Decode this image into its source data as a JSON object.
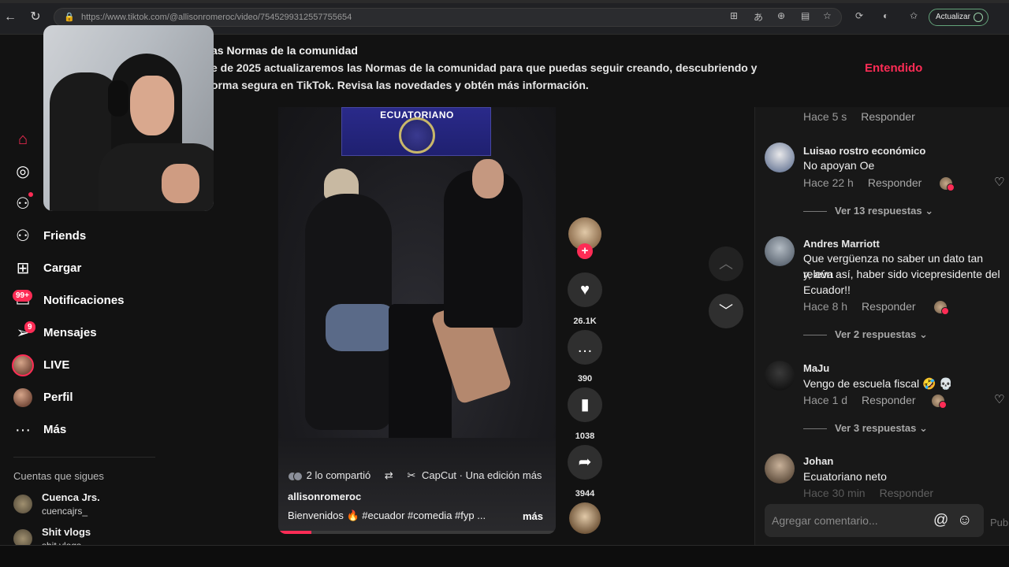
{
  "browser": {
    "url": "https://www.tiktok.com/@allisonromeroc/video/7545299312557755654",
    "update_label": "Actualizar"
  },
  "banner": {
    "line1": "as Normas de la comunidad",
    "line2": "e de 2025 actualizaremos las Normas de la comunidad para que puedas seguir creando, descubriendo y",
    "line3": "orma segura en TikTok. Revisa las novedades y obtén más información.",
    "ok_label": "Entendido"
  },
  "sidebar": {
    "items": [
      {
        "label": "Friends"
      },
      {
        "label": "Cargar"
      },
      {
        "label": "Notificaciones",
        "badge": "99+"
      },
      {
        "label": "Mensajes",
        "badge": "9"
      },
      {
        "label": "LIVE"
      },
      {
        "label": "Perfil"
      },
      {
        "label": "Más"
      }
    ],
    "following_title": "Cuentas que sigues",
    "accounts": [
      {
        "name": "Cuenca Jrs.",
        "handle": "cuencajrs_"
      },
      {
        "name": "Shit vlogs",
        "handle": "shit vlogs"
      }
    ]
  },
  "video": {
    "sign_text": "ECUATORIANO",
    "shared": "2 lo compartió",
    "tool": "CapCut · Una edición más",
    "username": "allisonromeroc",
    "caption": "Bienvenidos 🔥  #ecuador  #comedia  #fyp  ...",
    "more": "más",
    "progress": 0.12
  },
  "actions": {
    "likes": "26.1K",
    "comments": "390",
    "saves": "1038",
    "shares": "3944"
  },
  "comments": {
    "top_meta": {
      "time": "Hace 5 s",
      "reply": "Responder"
    },
    "items": [
      {
        "name": "Luisao rostro económico",
        "text": "No apoyan Oe",
        "time": "Hace 22 h",
        "reply": "Responder",
        "more": "Ver 13 respuestas"
      },
      {
        "name": "Andres Marriott",
        "text_lines": [
          "Que vergüenza no saber un dato tan releva",
          "y, aún así, haber sido vicepresidente del",
          "Ecuador!!"
        ],
        "time": "Hace 8 h",
        "reply": "Responder",
        "more": "Ver 2 respuestas"
      },
      {
        "name": "MaJu",
        "text": "Vengo de escuela fiscal 🤣 💀",
        "time": "Hace 1 d",
        "reply": "Responder",
        "more": "Ver 3 respuestas"
      },
      {
        "name": "Johan",
        "text": "Ecuatoriano neto",
        "time": "Hace 30 min",
        "reply": "Responder"
      }
    ],
    "input_placeholder": "Agregar comentario...",
    "publish": "Publicar"
  }
}
